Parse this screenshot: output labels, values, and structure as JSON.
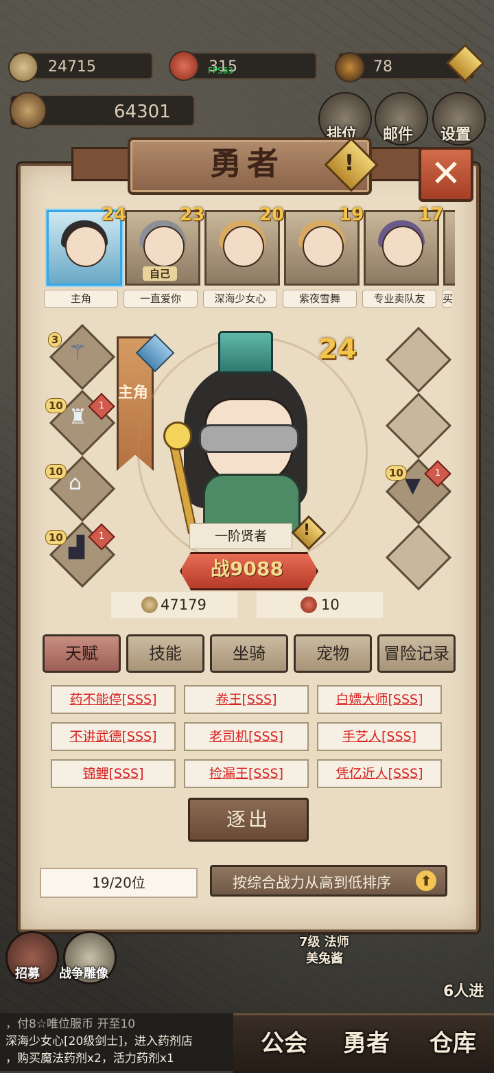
{
  "resources": {
    "gold": "24715",
    "gems": "315",
    "fps": "FPS63",
    "crystals": "78",
    "power_total": "64301"
  },
  "top_right": {
    "rank_label": "排位",
    "mail_label": "邮件",
    "settings_label": "设置"
  },
  "panel": {
    "title": "勇者",
    "warn": "!",
    "close": "✕"
  },
  "heroes": [
    {
      "level": "24",
      "name": "主角",
      "tag": ""
    },
    {
      "level": "23",
      "name": "一直爱你",
      "tag": "自己"
    },
    {
      "level": "20",
      "name": "深海少女心",
      "tag": ""
    },
    {
      "level": "19",
      "name": "紫夜雪舞",
      "tag": ""
    },
    {
      "level": "17",
      "name": "专业卖队友",
      "tag": ""
    },
    {
      "level": "",
      "name": "买",
      "tag": ""
    }
  ],
  "equipment": {
    "left": [
      {
        "level": "3",
        "red": ""
      },
      {
        "level": "10",
        "red": "1"
      },
      {
        "level": "10",
        "red": ""
      },
      {
        "level": "10",
        "red": "1"
      }
    ],
    "right_level": "10",
    "right_red": "1"
  },
  "character": {
    "ribbon": "主角",
    "level": "24",
    "class_name": "一阶贤者",
    "power_prefix": "战",
    "power": "9088",
    "gold_cost": "47179",
    "gem_cost": "10"
  },
  "tabs": [
    "天赋",
    "技能",
    "坐骑",
    "宠物",
    "冒险记录"
  ],
  "talents": [
    "药不能停[SSS]",
    "卷王[SSS]",
    "白嫖大师[SSS]",
    "不讲武德[SSS]",
    "老司机[SSS]",
    "手艺人[SSS]",
    "锦鲤[SSS]",
    "捡漏王[SSS]",
    "凭亿近人[SSS]"
  ],
  "actions": {
    "expel": "逐出",
    "count": "19/20位",
    "sort": "按综合战力从高到低排序",
    "sort_arrow": "⬆"
  },
  "bottom": {
    "recruit": "招募",
    "statue": "战争雕像",
    "map_label_1": "7级 法师",
    "map_label_2": "美兔酱",
    "players": "6人进",
    "chat_line_1": "，付8☆唯位服币 开至10",
    "chat_line_2": "深海少女心[20级剑士]，进入药剂店",
    "chat_line_3": "，购买魔法药剂x2，活力药剂x1",
    "nav_guild": "公会",
    "nav_hero": "勇者",
    "nav_storage": "仓库"
  },
  "colors": {
    "accent_red": "#d62020",
    "selected_blue": "#3aa6e0",
    "level_gold": "#f4c54a"
  }
}
